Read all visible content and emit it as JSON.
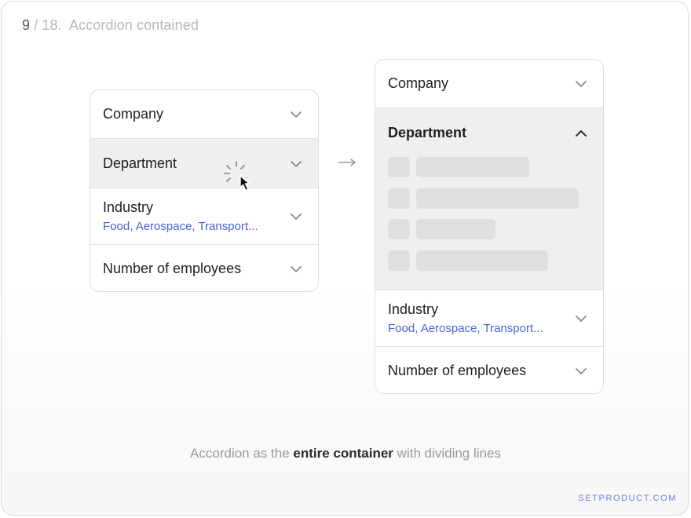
{
  "header": {
    "page_current": "9",
    "page_rest": " / 18.  ",
    "title": "Accordion contained"
  },
  "left_accordion": {
    "items": [
      {
        "label": "Company"
      },
      {
        "label": "Department"
      },
      {
        "label": "Industry",
        "value": "Food, Aerospace, Transport..."
      },
      {
        "label": "Number of employees"
      }
    ]
  },
  "right_accordion": {
    "items": [
      {
        "label": "Company"
      },
      {
        "label": "Department",
        "expanded": true
      },
      {
        "label": "Industry",
        "value": "Food, Aerospace, Transport..."
      },
      {
        "label": "Number of employees"
      }
    ]
  },
  "caption": {
    "prefix": "Accordion as the ",
    "emphasis": "entire container",
    "suffix": " with dividing lines"
  },
  "brand": "SETPRODUCT.COM",
  "colors": {
    "accent": "#4a63c9",
    "brand": "#6d7fd6",
    "highlight": "#efefef",
    "skeleton": "#dfdfdf"
  }
}
